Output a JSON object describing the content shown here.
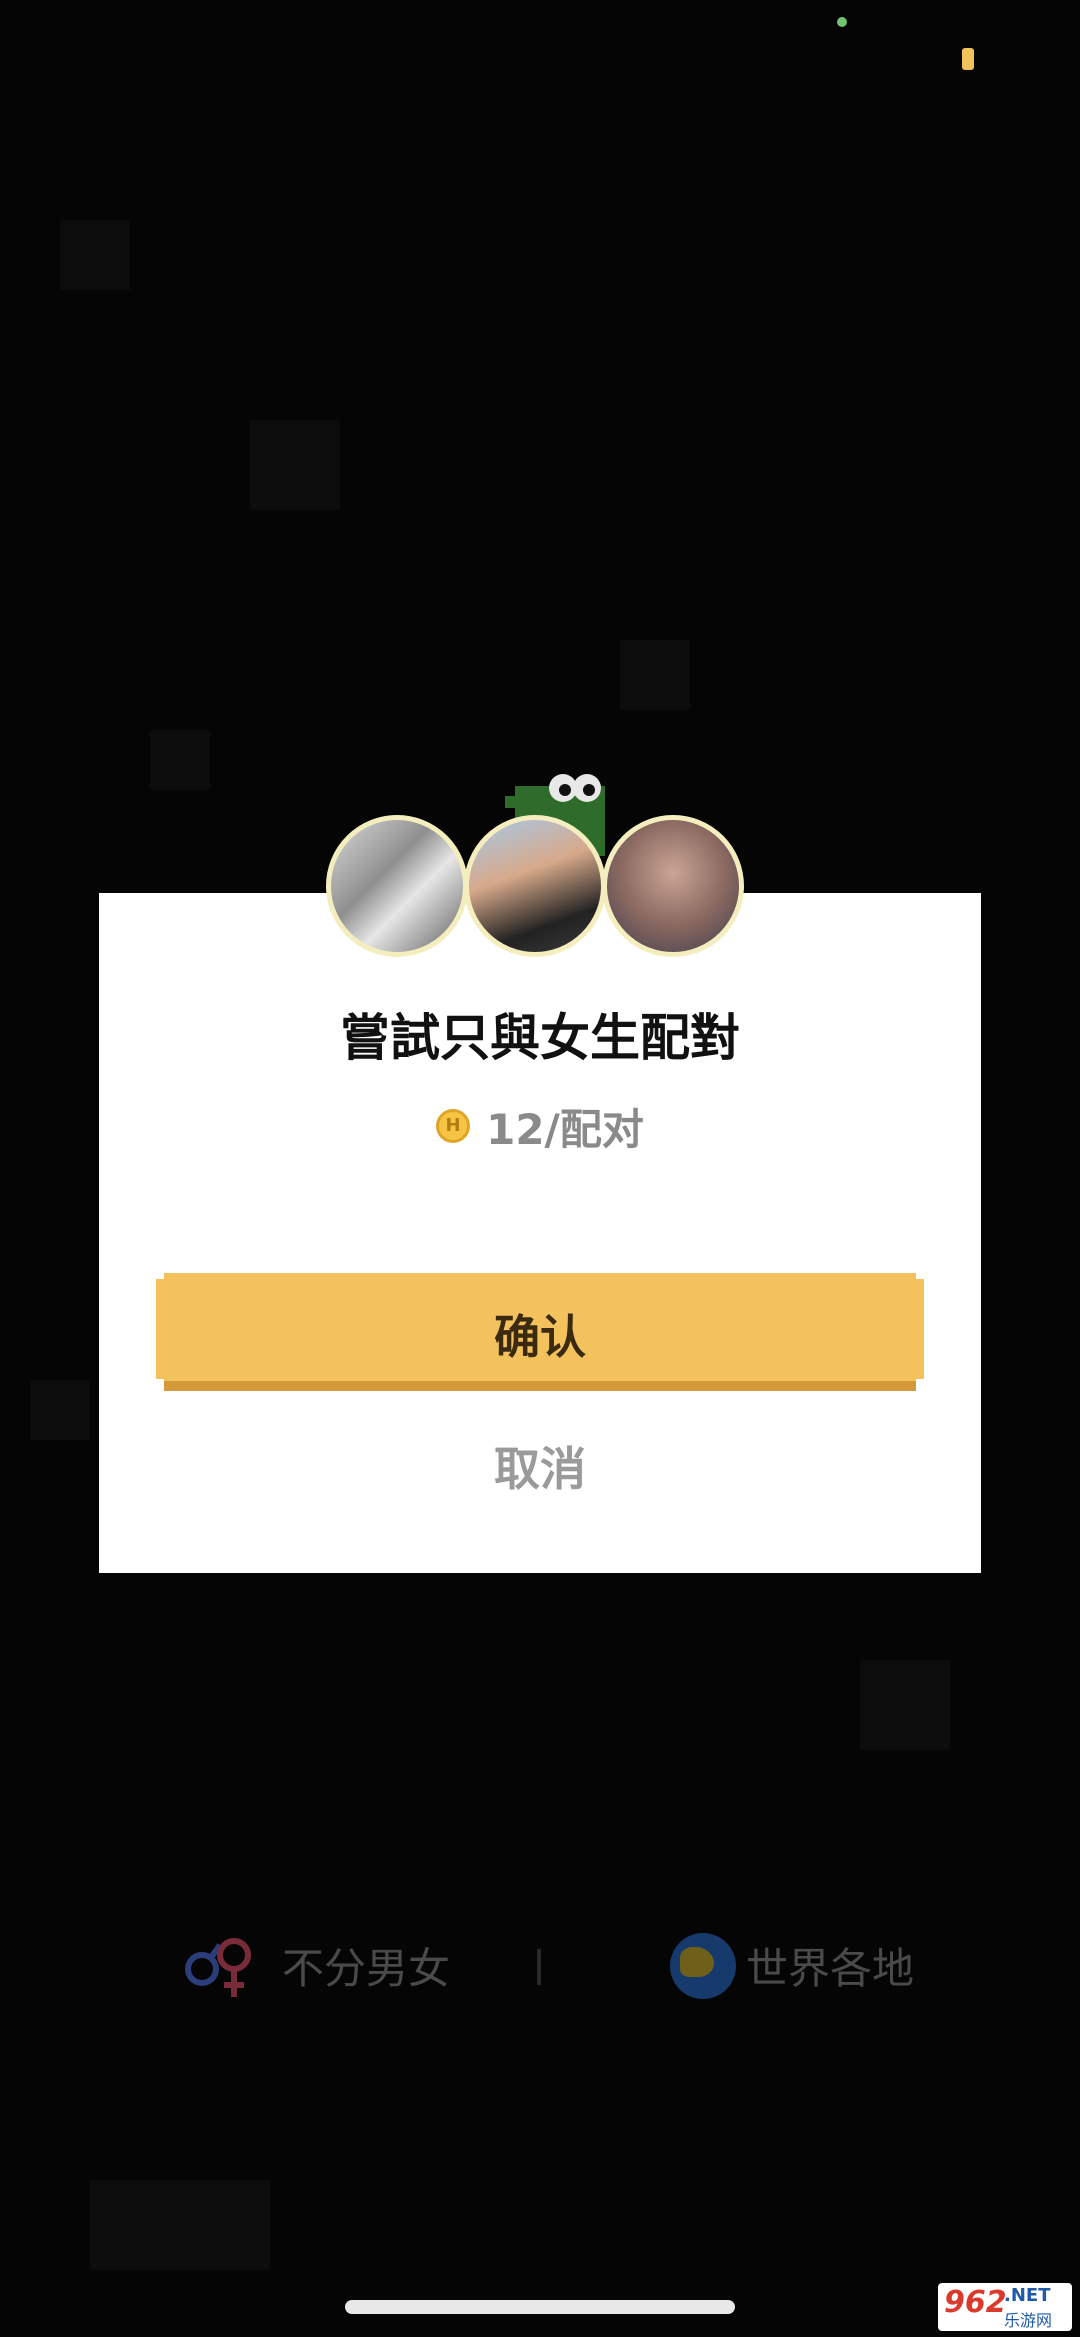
{
  "modal": {
    "title": "嘗試只與女生配對",
    "coin_icon_letter": "H",
    "price": "12/配对",
    "confirm_label": "确认",
    "cancel_label": "取消",
    "avatars": [
      "avatar-photo-couple",
      "avatar-photo-woman",
      "avatar-photo-tree"
    ]
  },
  "filter_bar": {
    "gender_label": "不分男女",
    "region_label": "世界各地"
  },
  "watermark": {
    "brand": "962",
    "suffix": ".NET",
    "subtitle": "乐游网"
  },
  "colors": {
    "accent": "#f4c25d",
    "accent_shadow": "#d49a3a",
    "modal_bg": "#ffffff",
    "overlay": "#050505"
  }
}
